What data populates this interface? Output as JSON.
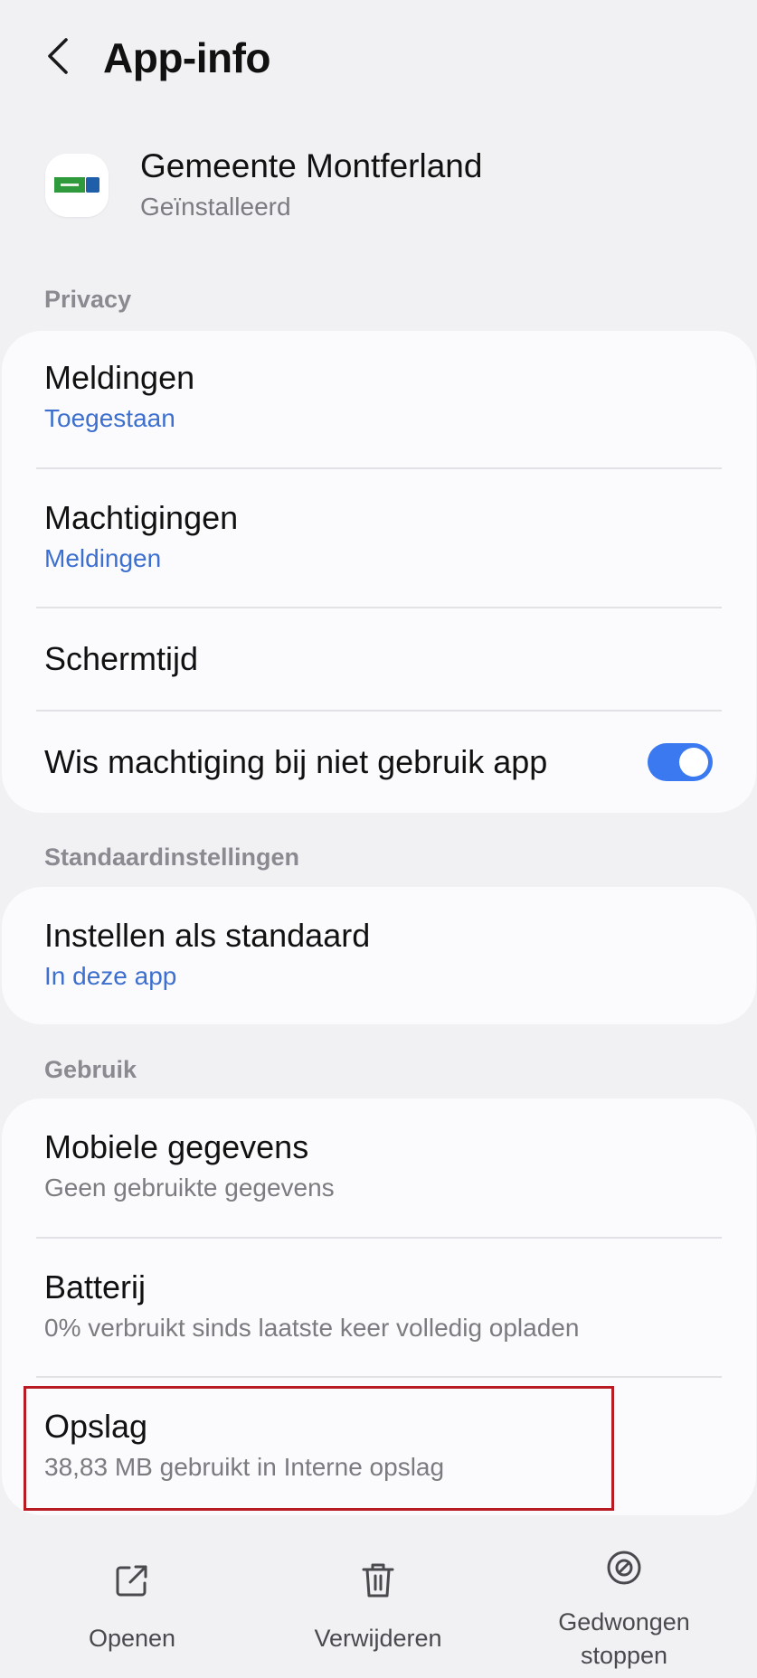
{
  "header": {
    "title": "App-info",
    "back_icon": "chevron-left-icon"
  },
  "app": {
    "name": "Gemeente Montferland",
    "status": "Geïnstalleerd",
    "icon": "app-logo-icon"
  },
  "sections": {
    "privacy": {
      "label": "Privacy",
      "items": [
        {
          "title": "Meldingen",
          "subtitle": "Toegestaan"
        },
        {
          "title": "Machtigingen",
          "subtitle": "Meldingen"
        },
        {
          "title": "Schermtijd"
        },
        {
          "title": "Wis machtiging bij niet gebruik app",
          "toggle_on": true
        }
      ]
    },
    "defaults": {
      "label": "Standaardinstellingen",
      "items": [
        {
          "title": "Instellen als standaard",
          "subtitle": "In deze app"
        }
      ]
    },
    "usage": {
      "label": "Gebruik",
      "items": [
        {
          "title": "Mobiele gegevens",
          "subtitle": "Geen gebruikte gegevens"
        },
        {
          "title": "Batterij",
          "subtitle": "0% verbruikt sinds laatste keer volledig opladen"
        },
        {
          "title": "Opslag",
          "subtitle": "38,83 MB gebruikt in Interne opslag"
        }
      ]
    }
  },
  "actions": [
    {
      "label": "Openen",
      "icon": "open-external-icon"
    },
    {
      "label": "Verwijderen",
      "icon": "trash-icon"
    },
    {
      "label": "Gedwongen stoppen",
      "icon": "stop-icon"
    }
  ],
  "colors": {
    "background": "#f1f1f4",
    "card": "#fbfbfd",
    "accent_blue": "#3d6fcf",
    "toggle": "#3b79f0",
    "highlight": "#b81c22"
  }
}
